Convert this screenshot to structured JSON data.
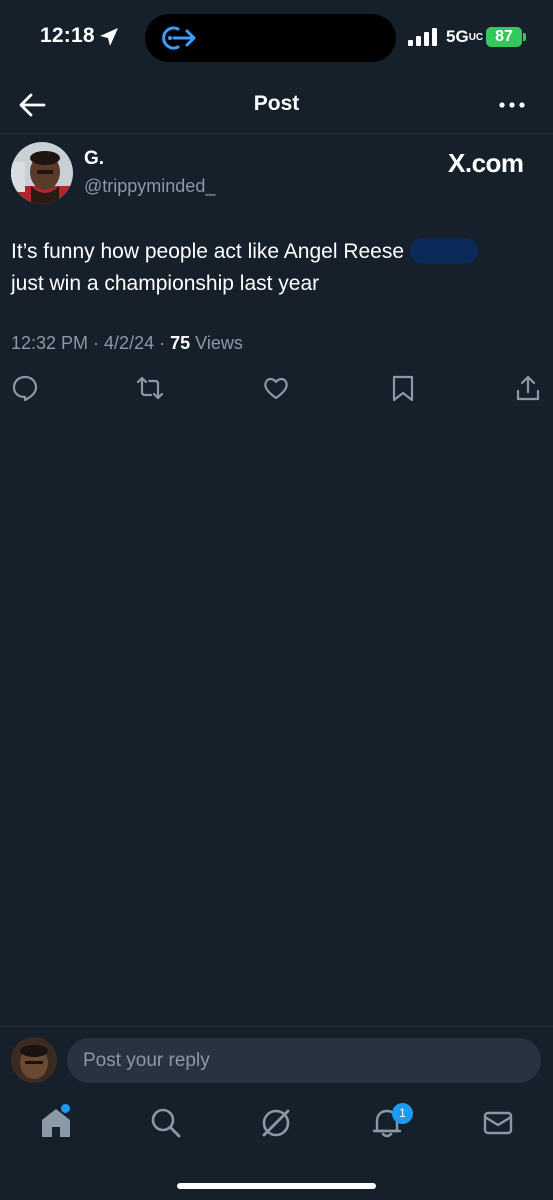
{
  "status_bar": {
    "time": "12:18",
    "network": "5G",
    "network_suffix": "UC",
    "battery": "87"
  },
  "header": {
    "title": "Post"
  },
  "tweet": {
    "display_name": "G.",
    "handle": "@trippyminded_",
    "watermark": "X.com",
    "text_line1": "It’s funny how people act like Angel Reese",
    "text_line2": "just win a championship last year",
    "time": "12:32 PM",
    "date": "4/2/24",
    "views_count": "75",
    "views_label": "Views"
  },
  "actions": [
    "reply-icon",
    "retweet-icon",
    "like-icon",
    "bookmark-icon",
    "share-icon"
  ],
  "reply": {
    "placeholder": "Post your reply"
  },
  "tab_bar": {
    "items": [
      "home-icon",
      "search-icon",
      "grok-icon",
      "notifications-icon",
      "messages-icon"
    ],
    "notification_count": "1"
  },
  "colors": {
    "background": "#15202b",
    "accent": "#1d9bf0",
    "muted_text": "#8b98a5",
    "battery": "#34c759"
  }
}
